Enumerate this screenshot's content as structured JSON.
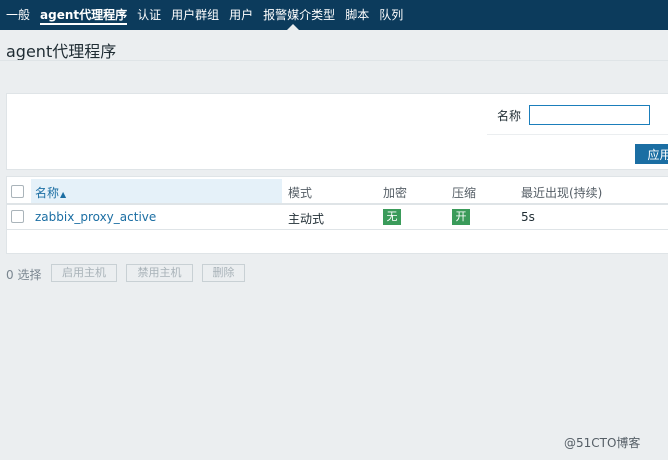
{
  "nav": {
    "tabs": [
      {
        "label": "一般",
        "active": false
      },
      {
        "label": "agent代理程序",
        "active": true
      },
      {
        "label": "认证",
        "active": false
      },
      {
        "label": "用户群组",
        "active": false
      },
      {
        "label": "用户",
        "active": false
      },
      {
        "label": "报警媒介类型",
        "active": false
      },
      {
        "label": "脚本",
        "active": false
      },
      {
        "label": "队列",
        "active": false
      }
    ]
  },
  "page": {
    "title": "agent代理程序"
  },
  "filter": {
    "name_label": "名称",
    "name_value": "",
    "apply_label": "应用"
  },
  "table": {
    "headers": {
      "name": "名称",
      "sort_arrow": "▲",
      "mode": "模式",
      "encryption": "加密",
      "compression": "压缩",
      "last_seen": "最近出现(持续)"
    },
    "rows": [
      {
        "name": "zabbix_proxy_active",
        "mode": "主动式",
        "encryption": "无",
        "compression": "开",
        "last_seen": "5s"
      }
    ]
  },
  "footer": {
    "selected": "0 选择",
    "enable_hosts": "启用主机",
    "disable_hosts": "禁用主机",
    "delete": "删除"
  },
  "watermark": "@51CTO博客",
  "colors": {
    "nav_bg": "#0c3b5c",
    "link": "#1b6ea3",
    "badge_green": "#3a9b5a",
    "page_bg": "#ebeef0"
  }
}
